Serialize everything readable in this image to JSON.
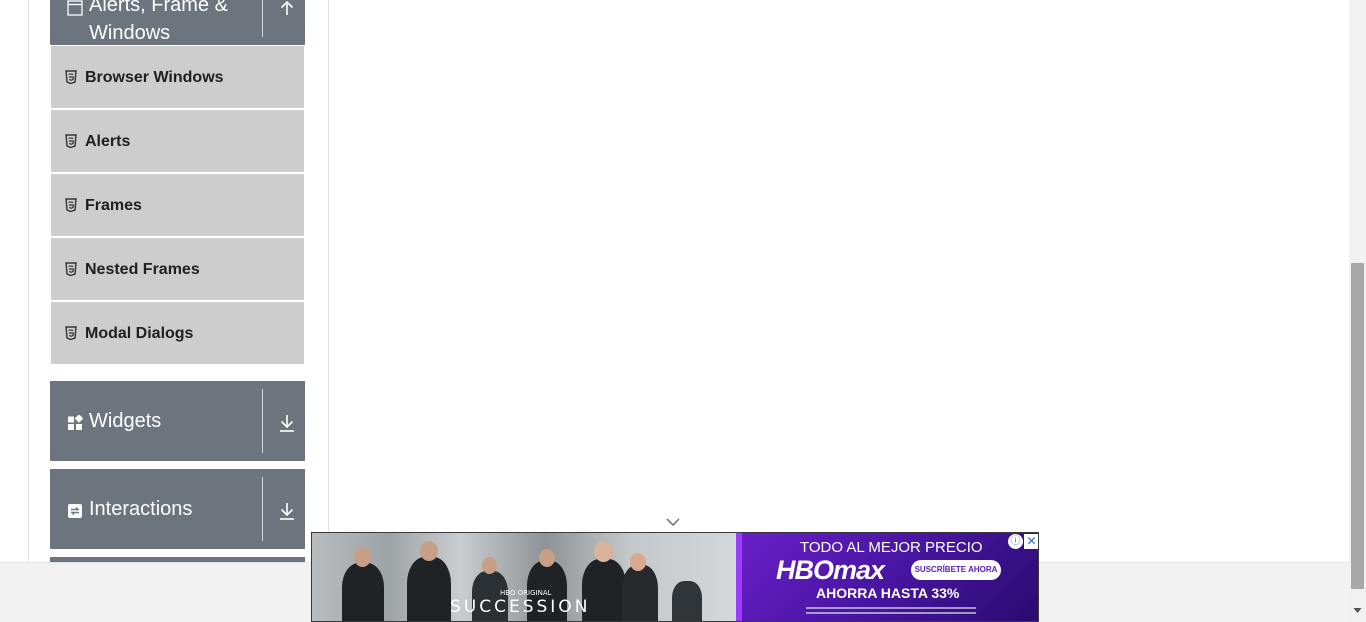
{
  "sidebar": {
    "alerts_group": {
      "title_line1": "Alerts, Frame &",
      "title_line2": "Windows",
      "icon": "window-icon",
      "toggle_icon": "collapse-up-icon",
      "items": [
        {
          "label": "Browser Windows",
          "icon": "html5-icon"
        },
        {
          "label": "Alerts",
          "icon": "html5-icon"
        },
        {
          "label": "Frames",
          "icon": "html5-icon"
        },
        {
          "label": "Nested Frames",
          "icon": "html5-icon"
        },
        {
          "label": "Modal Dialogs",
          "icon": "html5-icon"
        }
      ]
    },
    "widgets_group": {
      "title": "Widgets",
      "icon": "widgets-icon",
      "toggle_icon": "expand-down-icon"
    },
    "interactions_group": {
      "title": "Interactions",
      "icon": "interactions-icon",
      "toggle_icon": "expand-down-icon"
    }
  },
  "ad": {
    "show_name": "SUCCESSION",
    "hbo_original": "HBO ORIGINAL",
    "headline": "TODO AL MEJOR PRECIO",
    "logo": "HBOmax",
    "cta": "SUSCRÍBETE AHORA",
    "savings": "AHORRA HASTA 33%",
    "info_icon": "info-icon",
    "close_icon": "close-icon",
    "collapse_icon": "chevron-down-icon"
  },
  "colors": {
    "group_bg": "#6c757d",
    "item_bg": "#cdcdcd",
    "ad_purple": "#5a1bb8"
  }
}
